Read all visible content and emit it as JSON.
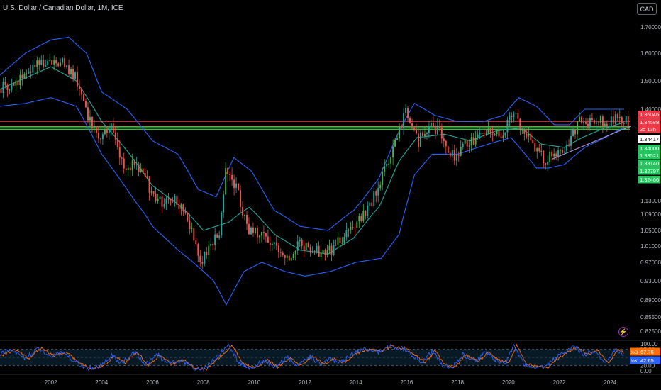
{
  "header": {
    "title": "U.S. Dollar / Canadian Dollar, 1M, ICE",
    "currency_label": "CAD"
  },
  "icons": {
    "alert": "lightning-icon"
  },
  "colors": {
    "background": "#000000",
    "up": "#26a69a",
    "up_bright": "#4caf50",
    "down": "#ef5350",
    "band": "#2962ff",
    "basis": "#26a69a",
    "k_line": "#2962ff",
    "d_line": "#ff6d00",
    "red_level": "#f23645",
    "green_level": "#4caf50",
    "trend_line": "#b39ddb"
  },
  "chart_data": [
    {
      "type": "candlestick",
      "title": "U.S. Dollar / Canadian Dollar, 1M, ICE",
      "x_ticks": [
        "2002",
        "2004",
        "2006",
        "2008",
        "2010",
        "2012",
        "2014",
        "2016",
        "2018",
        "2020",
        "2022",
        "2024"
      ],
      "x_range": [
        2000.0,
        2024.8
      ],
      "y_ticks": [
        "1.70000",
        "1.60000",
        "1.50000",
        "1.40000",
        "1.13000",
        "1.09000",
        "1.05000",
        "1.01000",
        "0.97000",
        "0.93000",
        "0.89000",
        "0.85500",
        "0.82500"
      ],
      "y_tick_values": [
        1.7,
        1.6,
        1.5,
        1.4,
        1.13,
        1.09,
        1.05,
        1.01,
        0.97,
        0.93,
        0.89,
        0.855,
        0.825
      ],
      "y_scale": "log",
      "ylim": [
        0.82,
        1.75
      ],
      "anchors": [
        [
          2000.0,
          1.47
        ],
        [
          2000.6,
          1.49
        ],
        [
          2001.2,
          1.54
        ],
        [
          2001.9,
          1.58
        ],
        [
          2002.5,
          1.56
        ],
        [
          2003.0,
          1.52
        ],
        [
          2003.4,
          1.4
        ],
        [
          2003.9,
          1.32
        ],
        [
          2004.4,
          1.34
        ],
        [
          2004.9,
          1.22
        ],
        [
          2005.4,
          1.24
        ],
        [
          2005.9,
          1.17
        ],
        [
          2006.4,
          1.12
        ],
        [
          2006.9,
          1.14
        ],
        [
          2007.4,
          1.09
        ],
        [
          2007.9,
          0.97
        ],
        [
          2008.3,
          1.01
        ],
        [
          2008.7,
          1.05
        ],
        [
          2008.9,
          1.22
        ],
        [
          2009.3,
          1.17
        ],
        [
          2009.8,
          1.05
        ],
        [
          2010.3,
          1.04
        ],
        [
          2010.8,
          1.01
        ],
        [
          2011.3,
          0.97
        ],
        [
          2011.8,
          1.02
        ],
        [
          2012.4,
          1.0
        ],
        [
          2012.9,
          0.99
        ],
        [
          2013.5,
          1.03
        ],
        [
          2013.9,
          1.06
        ],
        [
          2014.4,
          1.09
        ],
        [
          2014.9,
          1.16
        ],
        [
          2015.5,
          1.28
        ],
        [
          2016.0,
          1.39
        ],
        [
          2016.5,
          1.3
        ],
        [
          2016.9,
          1.34
        ],
        [
          2017.4,
          1.33
        ],
        [
          2017.8,
          1.25
        ],
        [
          2018.3,
          1.29
        ],
        [
          2018.8,
          1.31
        ],
        [
          2019.3,
          1.34
        ],
        [
          2019.8,
          1.32
        ],
        [
          2020.2,
          1.4
        ],
        [
          2020.7,
          1.32
        ],
        [
          2021.1,
          1.27
        ],
        [
          2021.5,
          1.24
        ],
        [
          2021.9,
          1.27
        ],
        [
          2022.4,
          1.28
        ],
        [
          2022.8,
          1.36
        ],
        [
          2023.3,
          1.35
        ],
        [
          2023.8,
          1.36
        ],
        [
          2024.3,
          1.37
        ],
        [
          2024.7,
          1.36
        ]
      ],
      "bands": [
        {
          "name": "upper",
          "points": [
            [
              2000.0,
              1.52
            ],
            [
              2001.0,
              1.6
            ],
            [
              2002.0,
              1.65
            ],
            [
              2002.7,
              1.66
            ],
            [
              2003.4,
              1.6
            ],
            [
              2004.0,
              1.46
            ],
            [
              2005.0,
              1.4
            ],
            [
              2006.0,
              1.3
            ],
            [
              2007.0,
              1.26
            ],
            [
              2007.8,
              1.16
            ],
            [
              2008.5,
              1.14
            ],
            [
              2009.2,
              1.25
            ],
            [
              2009.9,
              1.21
            ],
            [
              2010.8,
              1.1
            ],
            [
              2011.8,
              1.06
            ],
            [
              2012.9,
              1.05
            ],
            [
              2013.9,
              1.1
            ],
            [
              2014.9,
              1.19
            ],
            [
              2015.7,
              1.33
            ],
            [
              2016.3,
              1.42
            ],
            [
              2017.1,
              1.38
            ],
            [
              2018.0,
              1.36
            ],
            [
              2019.0,
              1.36
            ],
            [
              2019.8,
              1.38
            ],
            [
              2020.4,
              1.44
            ],
            [
              2021.1,
              1.41
            ],
            [
              2021.8,
              1.35
            ],
            [
              2022.4,
              1.35
            ],
            [
              2023.0,
              1.4
            ],
            [
              2023.8,
              1.4
            ],
            [
              2024.5,
              1.4
            ]
          ]
        },
        {
          "name": "basis",
          "points": [
            [
              2000.0,
              1.47
            ],
            [
              2001.0,
              1.51
            ],
            [
              2002.0,
              1.55
            ],
            [
              2003.0,
              1.5
            ],
            [
              2004.0,
              1.36
            ],
            [
              2005.0,
              1.27
            ],
            [
              2006.0,
              1.17
            ],
            [
              2007.0,
              1.12
            ],
            [
              2008.0,
              1.05
            ],
            [
              2009.0,
              1.07
            ],
            [
              2009.8,
              1.11
            ],
            [
              2010.8,
              1.04
            ],
            [
              2011.8,
              1.0
            ],
            [
              2012.9,
              0.99
            ],
            [
              2013.9,
              1.03
            ],
            [
              2014.9,
              1.11
            ],
            [
              2015.7,
              1.24
            ],
            [
              2016.4,
              1.31
            ],
            [
              2017.5,
              1.32
            ],
            [
              2018.5,
              1.3
            ],
            [
              2019.5,
              1.33
            ],
            [
              2020.5,
              1.34
            ],
            [
              2021.3,
              1.29
            ],
            [
              2022.2,
              1.28
            ],
            [
              2022.9,
              1.31
            ],
            [
              2023.8,
              1.34
            ],
            [
              2024.7,
              1.36
            ]
          ]
        },
        {
          "name": "lower",
          "points": [
            [
              2000.0,
              1.41
            ],
            [
              2001.0,
              1.42
            ],
            [
              2002.0,
              1.44
            ],
            [
              2003.0,
              1.41
            ],
            [
              2004.0,
              1.26
            ],
            [
              2005.0,
              1.16
            ],
            [
              2006.0,
              1.06
            ],
            [
              2007.0,
              1.0
            ],
            [
              2007.8,
              0.96
            ],
            [
              2008.4,
              0.93
            ],
            [
              2008.9,
              0.88
            ],
            [
              2009.6,
              0.95
            ],
            [
              2010.3,
              0.97
            ],
            [
              2011.2,
              0.95
            ],
            [
              2012.0,
              0.94
            ],
            [
              2013.0,
              0.95
            ],
            [
              2014.0,
              0.97
            ],
            [
              2015.0,
              0.98
            ],
            [
              2015.7,
              1.04
            ],
            [
              2016.3,
              1.2
            ],
            [
              2017.0,
              1.26
            ],
            [
              2018.0,
              1.26
            ],
            [
              2019.2,
              1.29
            ],
            [
              2020.1,
              1.31
            ],
            [
              2021.1,
              1.22
            ],
            [
              2021.6,
              1.22
            ],
            [
              2022.2,
              1.23
            ],
            [
              2023.0,
              1.28
            ],
            [
              2023.8,
              1.31
            ],
            [
              2024.5,
              1.34
            ]
          ]
        }
      ],
      "trend_line": [
        [
          2021.7,
          1.245
        ],
        [
          2024.8,
          1.345
        ]
      ],
      "level_lines": [
        {
          "value": 1.36046,
          "color": "red"
        },
        {
          "value": 1.34588,
          "color": "red"
        },
        {
          "value": 1.34417,
          "color": "green"
        },
        {
          "value": 1.34,
          "color": "green"
        },
        {
          "value": 1.33521,
          "color": "green"
        }
      ],
      "price_labels": [
        {
          "text": "1.36046",
          "style": "red"
        },
        {
          "text": "1.34588",
          "style": "red"
        },
        {
          "text": "2d 13h",
          "style": "red"
        },
        {
          "text": "1.34417",
          "style": "white"
        },
        {
          "text": "1.34000",
          "style": "green"
        },
        {
          "text": "1.33521",
          "style": "green"
        },
        {
          "text": "1.33140",
          "style": "green"
        },
        {
          "text": "1.32797",
          "style": "green"
        },
        {
          "text": "1.32466",
          "style": "green"
        }
      ]
    },
    {
      "type": "line",
      "title": "",
      "y_ticks": [
        "100.00",
        "80.00",
        "20.00",
        "0.00"
      ],
      "y_tick_values": [
        100,
        80,
        20,
        0
      ],
      "ylim": [
        0,
        100
      ],
      "dashed_levels": [
        80,
        50,
        20
      ],
      "series": [
        {
          "name": "%D",
          "value_label": "67.76"
        },
        {
          "name": "%K",
          "value_label": "42.65"
        }
      ],
      "anchors": [
        [
          2000.0,
          60
        ],
        [
          2000.5,
          80
        ],
        [
          2001.0,
          45
        ],
        [
          2001.5,
          85
        ],
        [
          2002.0,
          55
        ],
        [
          2002.5,
          70
        ],
        [
          2003.0,
          30
        ],
        [
          2003.4,
          10
        ],
        [
          2003.9,
          15
        ],
        [
          2004.4,
          55
        ],
        [
          2004.8,
          30
        ],
        [
          2005.3,
          70
        ],
        [
          2005.7,
          20
        ],
        [
          2006.2,
          60
        ],
        [
          2006.6,
          25
        ],
        [
          2007.1,
          40
        ],
        [
          2007.6,
          10
        ],
        [
          2008.0,
          5
        ],
        [
          2008.4,
          40
        ],
        [
          2008.8,
          75
        ],
        [
          2009.0,
          95
        ],
        [
          2009.4,
          30
        ],
        [
          2009.9,
          10
        ],
        [
          2010.4,
          40
        ],
        [
          2010.8,
          15
        ],
        [
          2011.3,
          50
        ],
        [
          2011.7,
          20
        ],
        [
          2012.2,
          55
        ],
        [
          2012.6,
          25
        ],
        [
          2013.0,
          45
        ],
        [
          2013.4,
          30
        ],
        [
          2013.9,
          65
        ],
        [
          2014.4,
          80
        ],
        [
          2014.9,
          70
        ],
        [
          2015.3,
          90
        ],
        [
          2015.8,
          85
        ],
        [
          2016.2,
          60
        ],
        [
          2016.6,
          30
        ],
        [
          2017.0,
          75
        ],
        [
          2017.4,
          20
        ],
        [
          2017.8,
          15
        ],
        [
          2018.2,
          60
        ],
        [
          2018.7,
          35
        ],
        [
          2019.1,
          70
        ],
        [
          2019.5,
          40
        ],
        [
          2019.9,
          30
        ],
        [
          2020.2,
          95
        ],
        [
          2020.6,
          25
        ],
        [
          2021.0,
          15
        ],
        [
          2021.4,
          10
        ],
        [
          2021.8,
          45
        ],
        [
          2022.2,
          70
        ],
        [
          2022.6,
          90
        ],
        [
          2023.0,
          60
        ],
        [
          2023.4,
          75
        ],
        [
          2023.8,
          30
        ],
        [
          2024.2,
          80
        ],
        [
          2024.6,
          55
        ]
      ]
    }
  ]
}
